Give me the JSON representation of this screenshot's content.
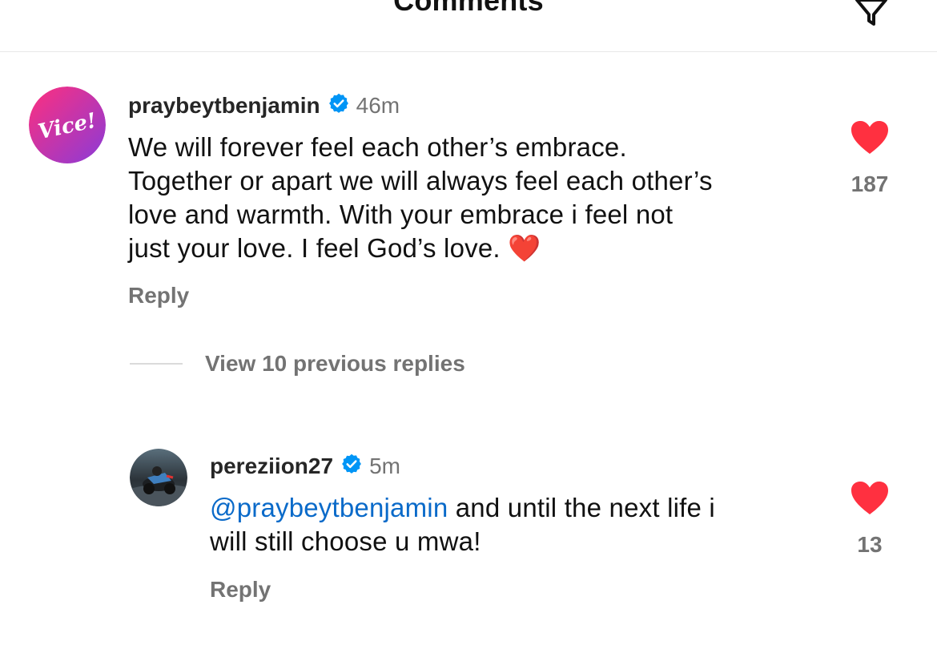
{
  "header": {
    "title": "Comments"
  },
  "comments": [
    {
      "username": "praybeytbenjamin",
      "time": "46m",
      "avatar_text": "Vice!",
      "lines": [
        "We will forever feel each other’s embrace.",
        "Together or apart we will always feel each other’s",
        "love and warmth. With your embrace i feel not",
        "just your love. I feel God’s love. ❤️"
      ],
      "reply_label": "Reply",
      "like_count": "187"
    }
  ],
  "view_replies": {
    "label": "View 10 previous replies"
  },
  "replies": [
    {
      "username": "pereziion27",
      "time": "5m",
      "mention": "@praybeytbenjamin",
      "text_after_mention": " and until the next life i",
      "line2": "will still choose u mwa!",
      "reply_label": "Reply",
      "like_count": "13"
    }
  ],
  "colors": {
    "heart": "#ff3040",
    "verified": "#0095f6",
    "mention": "#0a6ac9",
    "muted": "#737373"
  },
  "icons": {
    "filter": "filter-funnel-icon",
    "verified": "verified-badge-icon",
    "like": "heart-filled-icon"
  }
}
